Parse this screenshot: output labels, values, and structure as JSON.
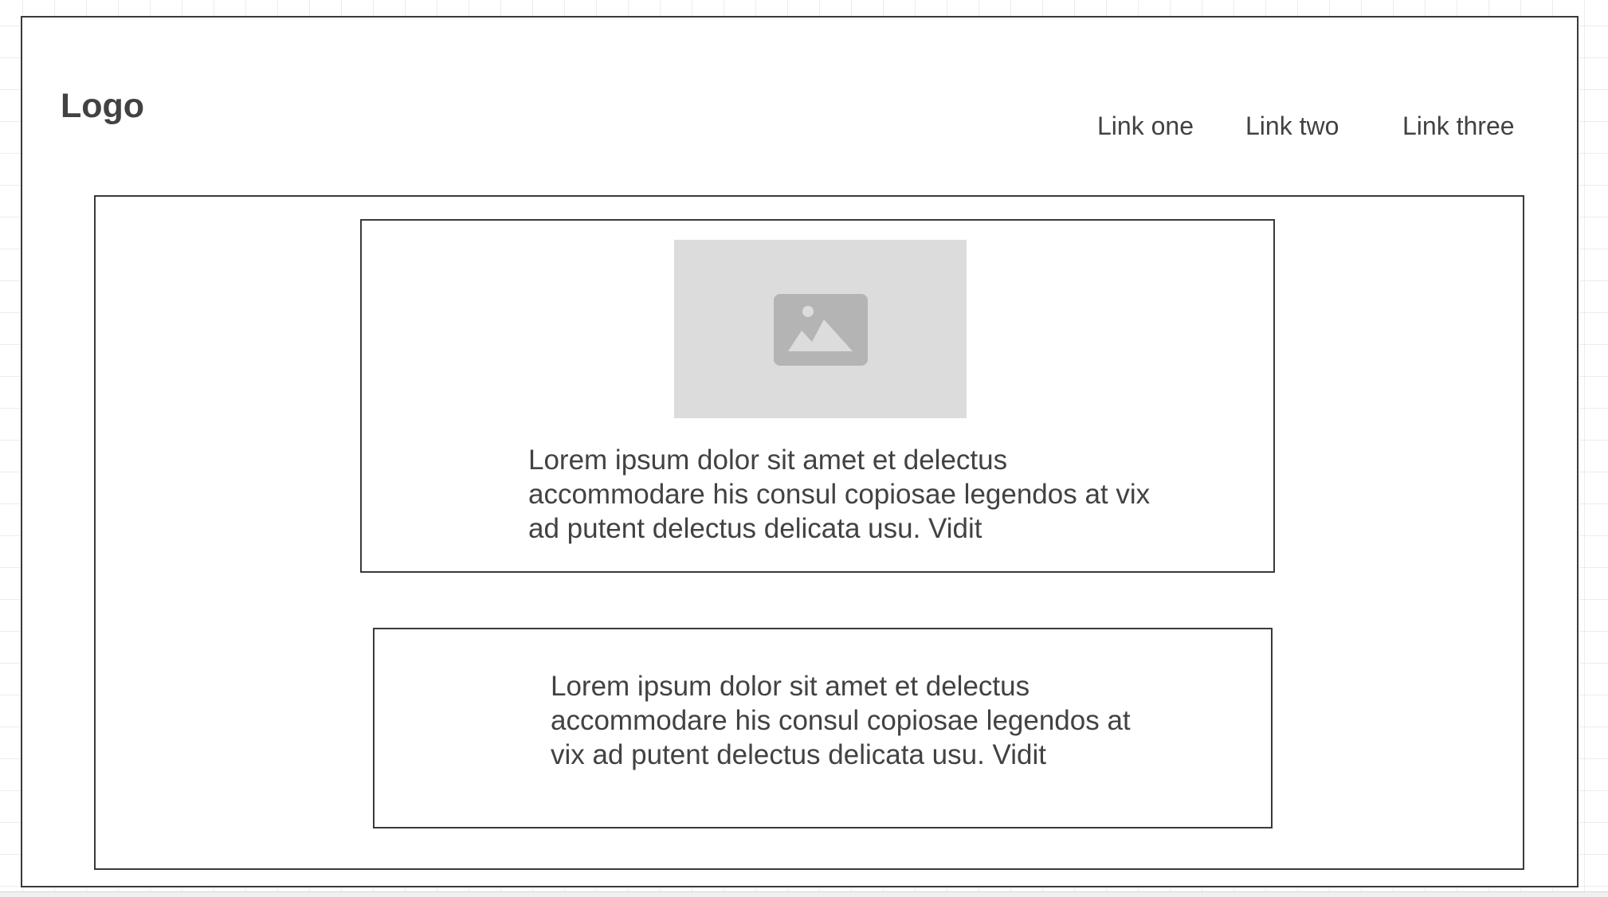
{
  "header": {
    "logo_text": "Logo",
    "nav_links": [
      "Link one",
      "Link two",
      "Link three"
    ]
  },
  "main": {
    "cards": [
      {
        "image": "image-placeholder-icon",
        "text": "Lorem ipsum dolor sit amet et delectus accommodare his consul copiosae legendos at vix ad putent delectus delicata usu. Vidit"
      },
      {
        "text": "Lorem ipsum dolor sit amet et delectus accommodare his consul copiosae legendos at vix ad putent delectus delicata usu. Vidit"
      }
    ]
  },
  "colors": {
    "text": "#424242",
    "border": "#3a3a3a",
    "image_placeholder_bg": "#dcdcdc",
    "image_icon": "#b4b4b4"
  }
}
